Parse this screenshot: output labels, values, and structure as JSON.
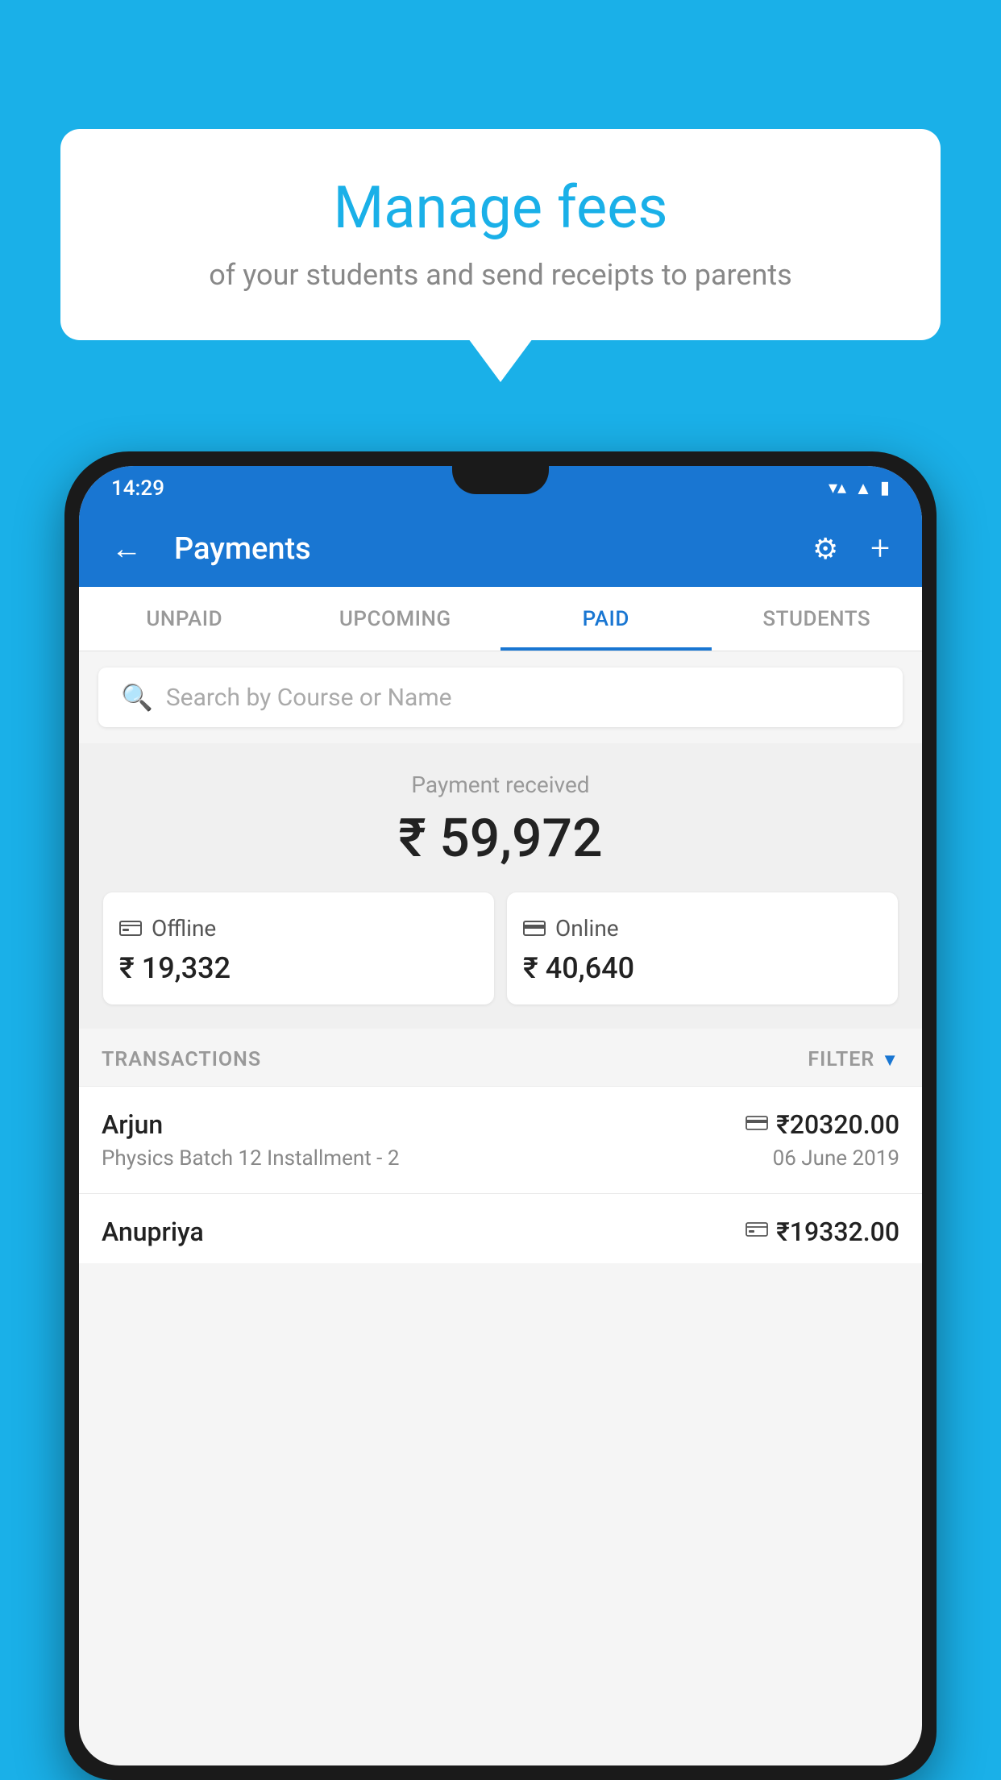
{
  "background": {
    "color": "#1ab0e8"
  },
  "bubble": {
    "title": "Manage fees",
    "subtitle": "of your students and send receipts to parents"
  },
  "statusBar": {
    "time": "14:29",
    "wifiIcon": "▼",
    "signalIcon": "▲",
    "batteryIcon": "▮"
  },
  "appBar": {
    "title": "Payments",
    "backIcon": "←",
    "settingsIcon": "⚙",
    "addIcon": "+"
  },
  "tabs": [
    {
      "id": "unpaid",
      "label": "UNPAID",
      "active": false
    },
    {
      "id": "upcoming",
      "label": "UPCOMING",
      "active": false
    },
    {
      "id": "paid",
      "label": "PAID",
      "active": true
    },
    {
      "id": "students",
      "label": "STUDENTS",
      "active": false
    }
  ],
  "search": {
    "placeholder": "Search by Course or Name"
  },
  "paymentSummary": {
    "label": "Payment received",
    "amount": "₹ 59,972",
    "offline": {
      "label": "Offline",
      "amount": "₹ 19,332"
    },
    "online": {
      "label": "Online",
      "amount": "₹ 40,640"
    }
  },
  "transactions": {
    "label": "TRANSACTIONS",
    "filterLabel": "FILTER",
    "items": [
      {
        "name": "Arjun",
        "course": "Physics Batch 12 Installment - 2",
        "amount": "₹20320.00",
        "date": "06 June 2019",
        "modeIcon": "card"
      },
      {
        "name": "Anupriya",
        "course": "",
        "amount": "₹19332.00",
        "date": "",
        "modeIcon": "offline"
      }
    ]
  }
}
